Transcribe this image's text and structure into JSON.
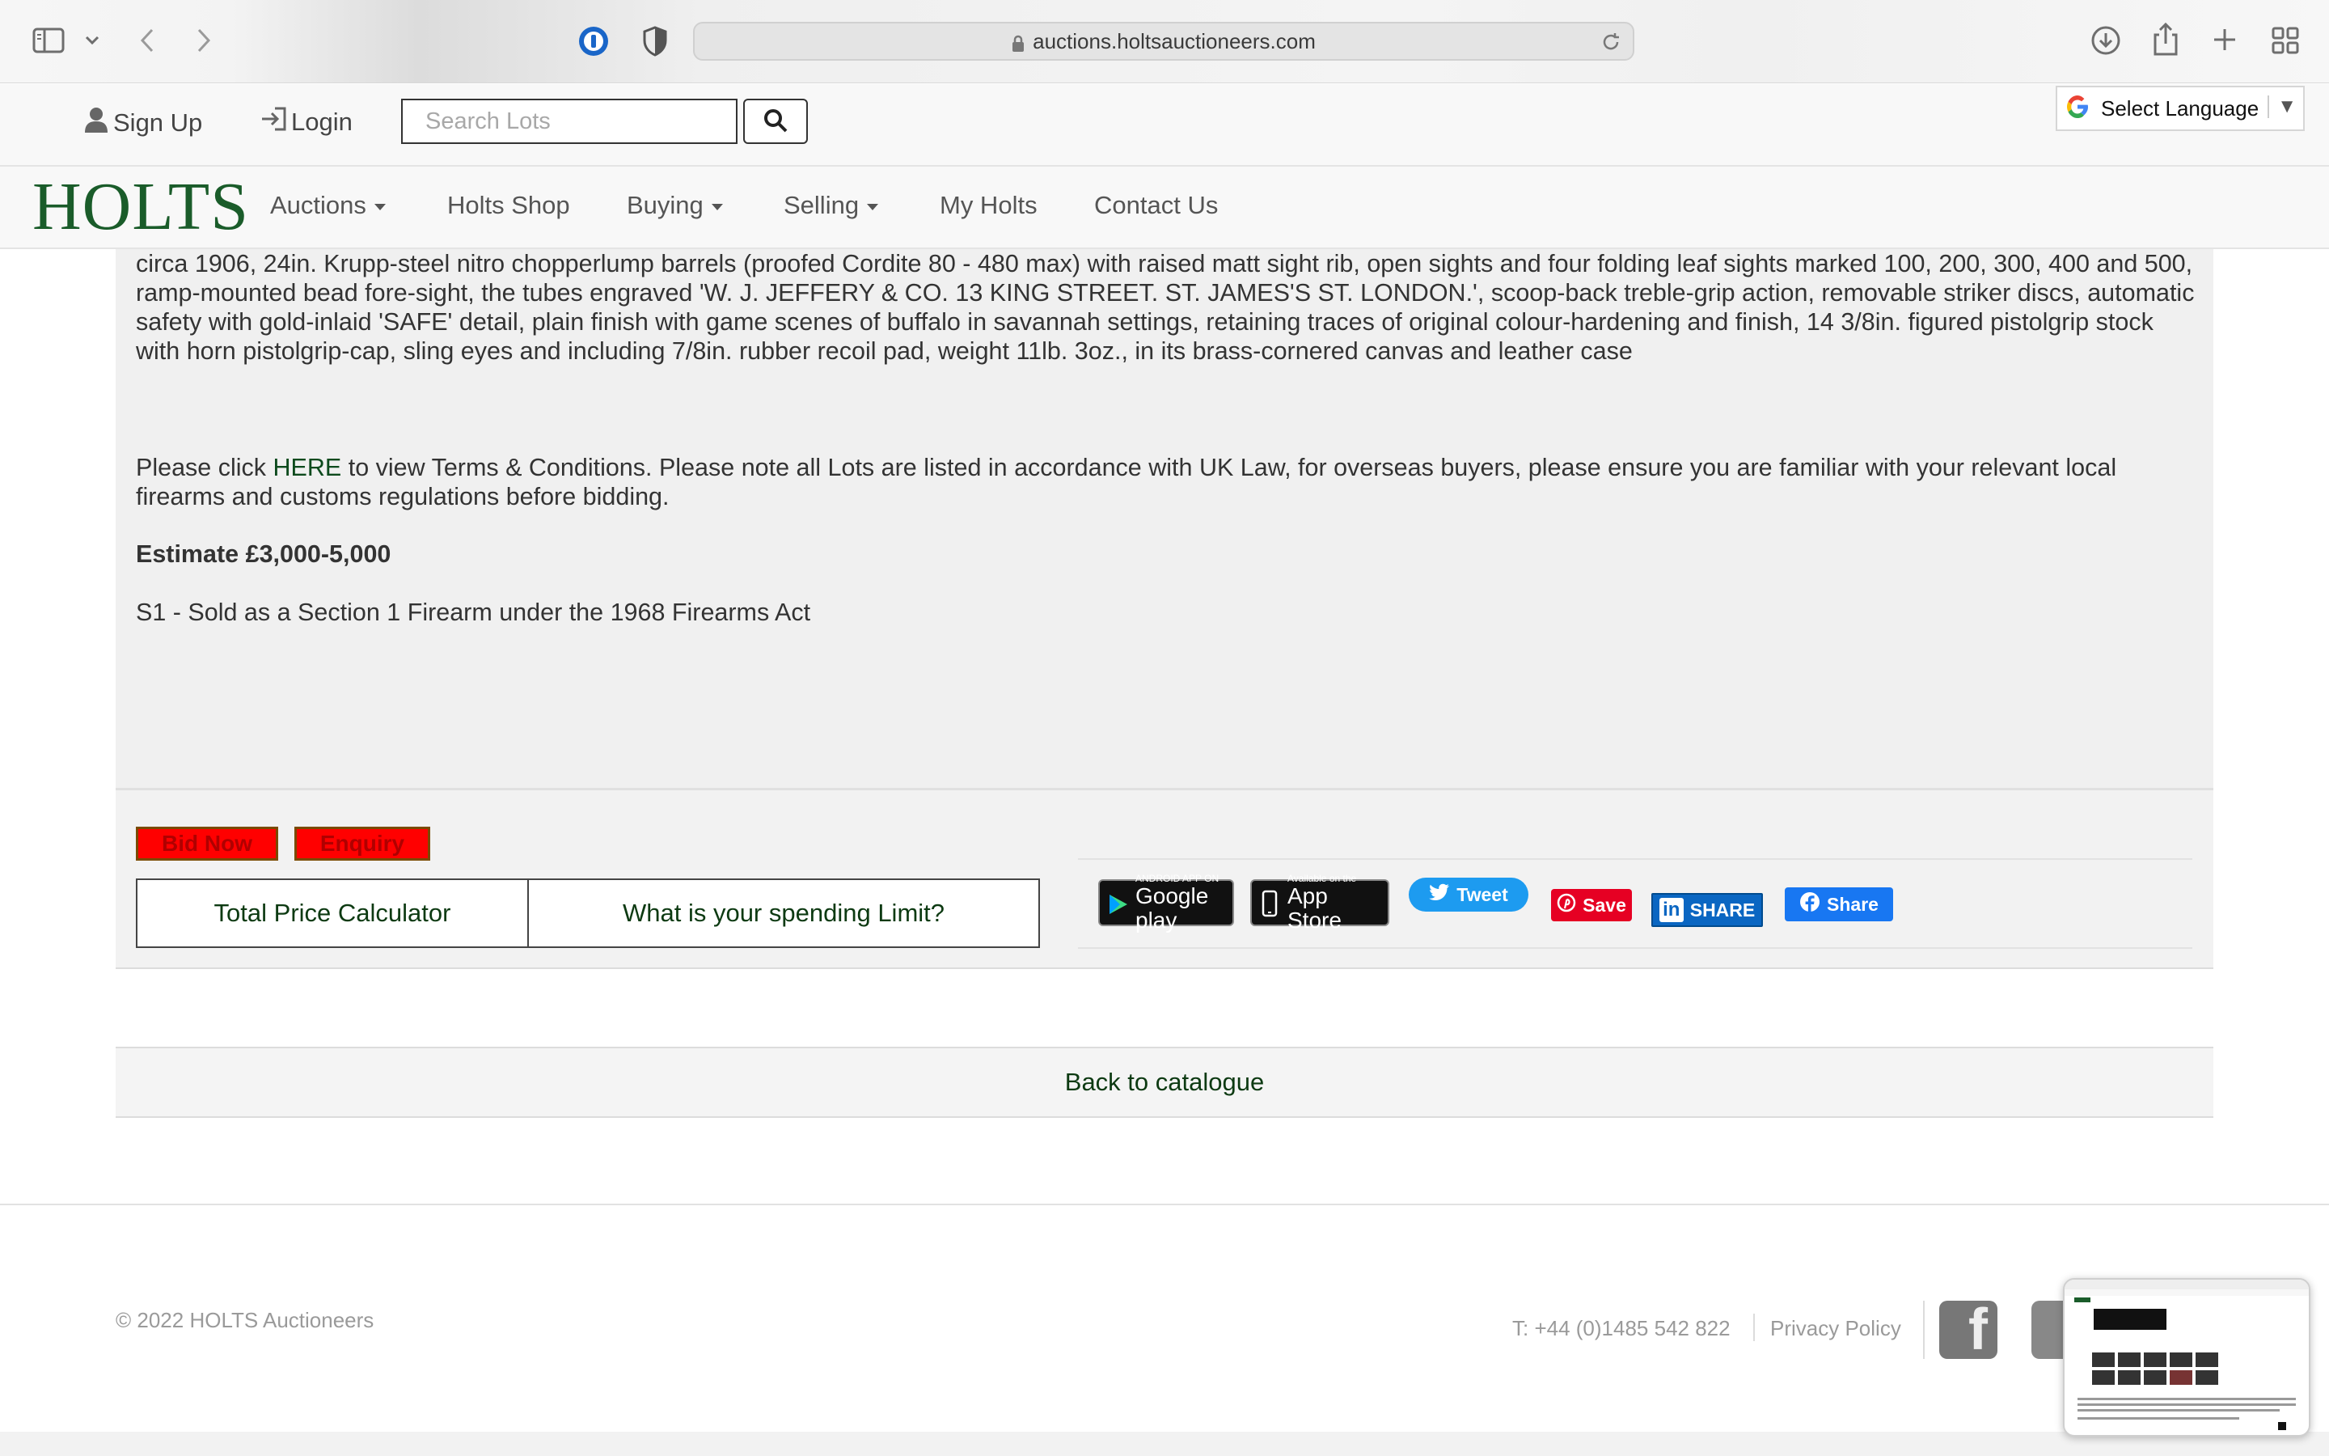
{
  "browser": {
    "url": "auctions.holtsauctioneers.com"
  },
  "utility": {
    "signup_label": "Sign Up",
    "login_label": "Login",
    "search_placeholder": "Search Lots",
    "language_label": "Select Language"
  },
  "nav": {
    "logo": "HOLTS",
    "items": [
      {
        "label": "Auctions",
        "has_dropdown": true
      },
      {
        "label": "Holts Shop",
        "has_dropdown": false
      },
      {
        "label": "Buying",
        "has_dropdown": true
      },
      {
        "label": "Selling",
        "has_dropdown": true
      },
      {
        "label": "My Holts",
        "has_dropdown": false
      },
      {
        "label": "Contact Us",
        "has_dropdown": false
      }
    ]
  },
  "lot": {
    "description": "circa 1906, 24in. Krupp-steel nitro chopperlump barrels (proofed Cordite 80 - 480 max) with raised matt sight rib, open sights and four folding leaf sights marked 100, 200, 300, 400 and 500, ramp-mounted bead fore-sight, the tubes engraved 'W. J. JEFFERY & CO. 13 KING STREET. ST. JAMES'S ST. LONDON.', scoop-back treble-grip action, removable striker discs, automatic safety with gold-inlaid 'SAFE' detail, plain finish with game scenes of buffalo in savannah settings, retaining traces of original colour-hardening and finish, 14 3/8in. figured pistolgrip stock with horn pistolgrip-cap, sling eyes and including 7/8in. rubber recoil pad, weight 11lb. 3oz., in its brass-cornered canvas and leather case",
    "terms_before": "Please click ",
    "terms_link": "HERE",
    "terms_after": " to view Terms & Conditions. Please note all Lots are listed in accordance with UK Law, for overseas buyers, please ensure you are familiar with your relevant local firearms and customs regulations before bidding.",
    "estimate": "Estimate £3,000-5,000",
    "section_note": "S1 - Sold as a Section 1 Firearm under the 1968 Firearms Act"
  },
  "actions": {
    "bid_now": "Bid Now",
    "enquiry": "Enquiry",
    "total_price_calculator": "Total Price Calculator",
    "spending_limit": "What is your spending Limit?",
    "google_play_small": "ANDROID APP ON",
    "google_play_big": "Google play",
    "app_store_small": "Available on the",
    "app_store_big": "App Store",
    "tweet": "Tweet",
    "pin_save": "Save",
    "linkedin_share": "SHARE",
    "fb_share": "Share",
    "back_to_catalogue": "Back to catalogue"
  },
  "footer": {
    "copyright": "© 2022 HOLTS Auctioneers",
    "phone": "T: +44 (0)1485 542 822",
    "privacy": "Privacy Policy"
  },
  "colors": {
    "brand_green": "#1a5c2a",
    "bid_red": "#ff0000",
    "twitter": "#1d9bf0",
    "pinterest": "#e60023",
    "linkedin": "#0a66c2",
    "facebook": "#1877f2"
  }
}
